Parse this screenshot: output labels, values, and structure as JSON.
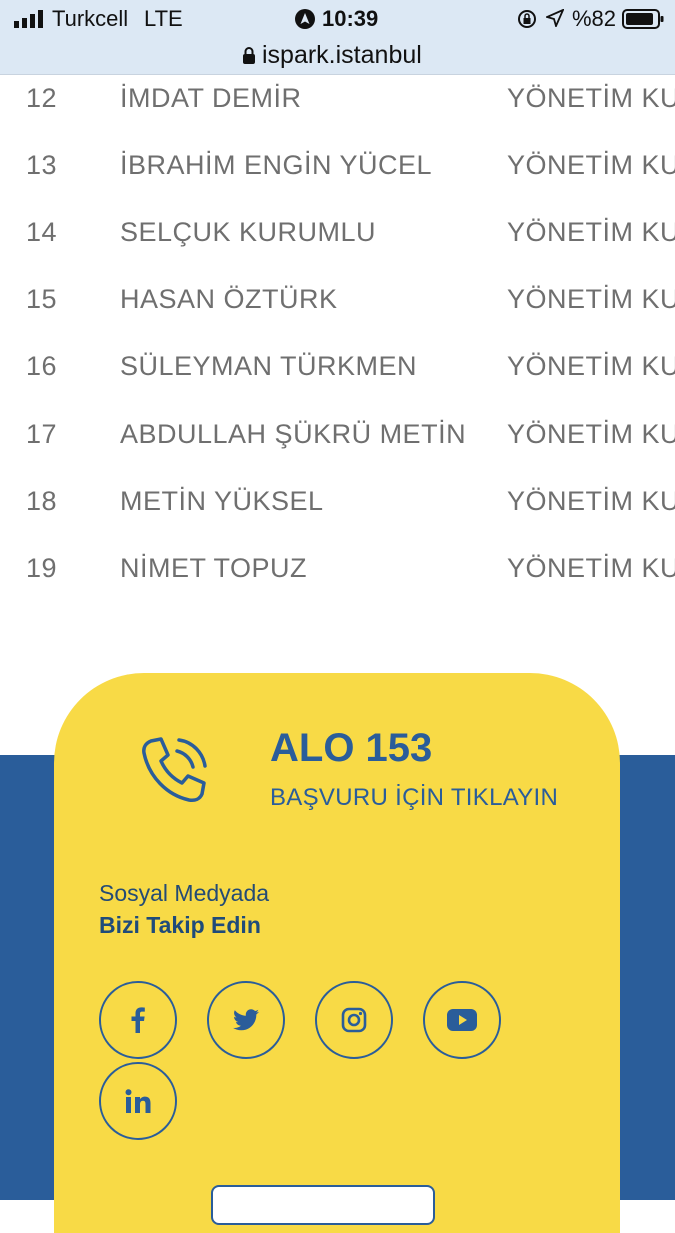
{
  "status_bar": {
    "carrier": "Turkcell",
    "network": "LTE",
    "time": "10:39",
    "battery": "%82"
  },
  "browser": {
    "url": "ispark.istanbul"
  },
  "members": [
    {
      "no": "12",
      "name": "İMDAT DEMİR",
      "role": "YÖNETİM KU"
    },
    {
      "no": "13",
      "name": "İBRAHİM ENGİN YÜCEL",
      "role": "YÖNETİM KU"
    },
    {
      "no": "14",
      "name": "SELÇUK KURUMLU",
      "role": "YÖNETİM KU"
    },
    {
      "no": "15",
      "name": "HASAN ÖZTÜRK",
      "role": "YÖNETİM KU"
    },
    {
      "no": "16",
      "name": "SÜLEYMAN TÜRKMEN",
      "role": "YÖNETİM KU"
    },
    {
      "no": "17",
      "name": "ABDULLAH ŞÜKRÜ METİN",
      "role": "YÖNETİM KU"
    },
    {
      "no": "18",
      "name": "METİN YÜKSEL",
      "role": "YÖNETİM KU"
    },
    {
      "no": "19",
      "name": "NİMET TOPUZ",
      "role": "YÖNETİM KU"
    }
  ],
  "contact": {
    "phone": "ALO 153",
    "apply_text": "BAŞVURU İÇİN TIKLAYIN"
  },
  "social": {
    "heading_line1": "Sosyal Medyada",
    "heading_line2": "Bizi Takip Edin",
    "icons": [
      "facebook-icon",
      "twitter-icon",
      "instagram-icon",
      "youtube-icon",
      "linkedin-icon"
    ]
  },
  "colors": {
    "yellow": "#f8da46",
    "blue": "#2a5d9a",
    "text_gray": "#6f6f6f"
  }
}
